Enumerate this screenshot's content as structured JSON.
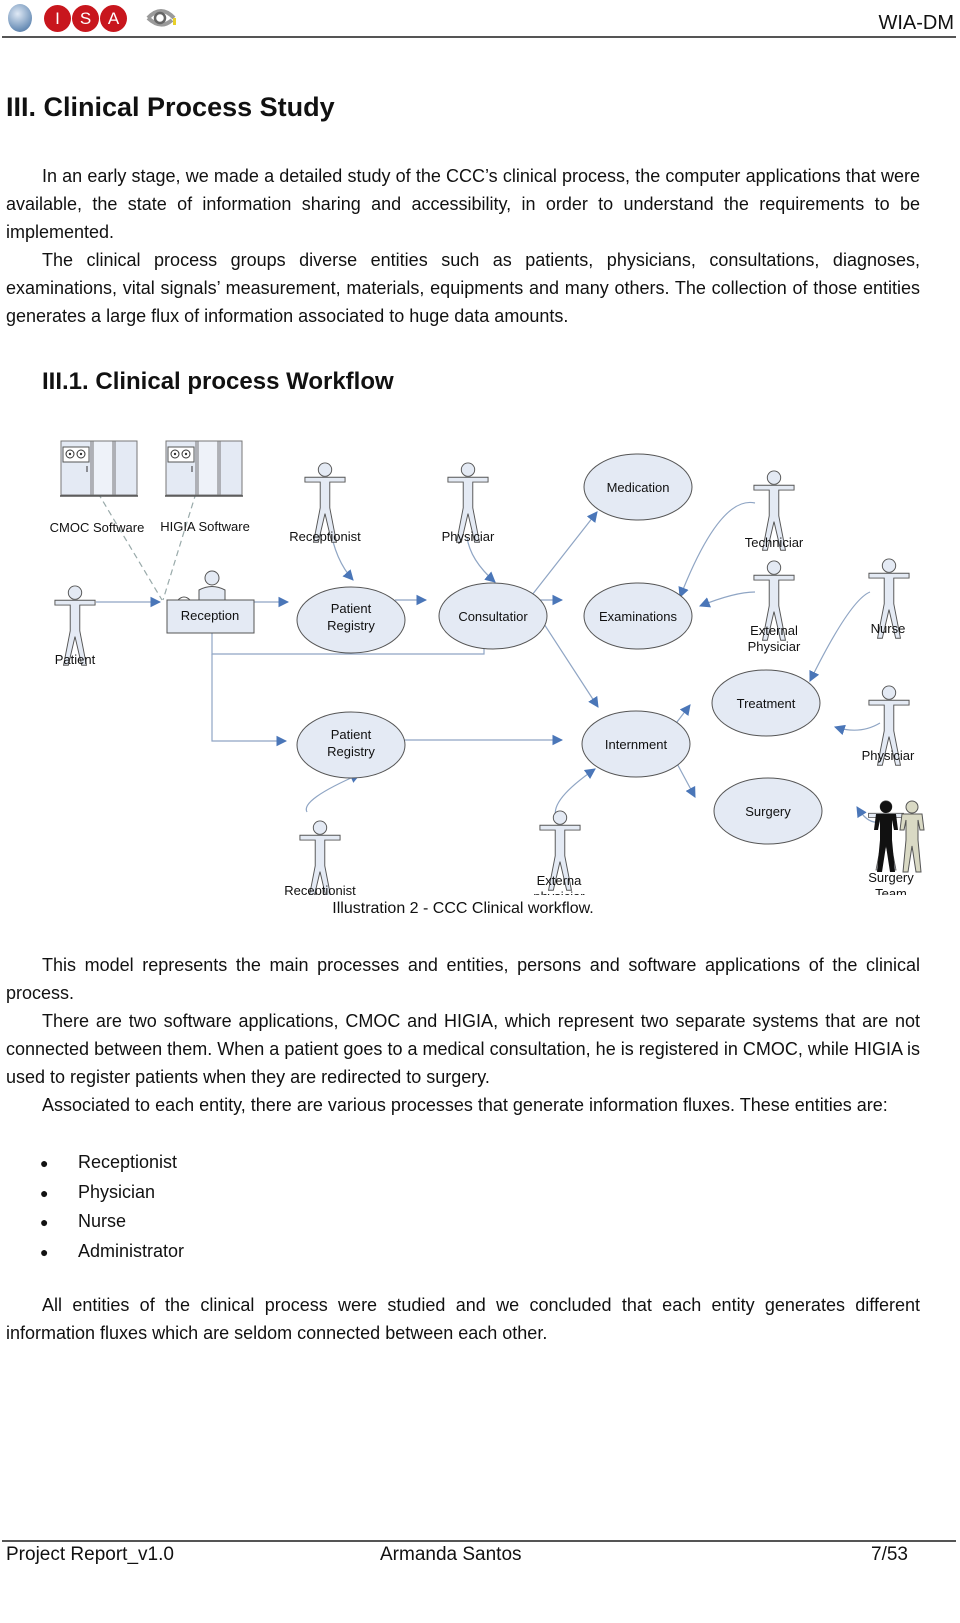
{
  "header": {
    "logos": [
      "globe-logo",
      "I",
      "S",
      "A",
      "eye-logo"
    ],
    "doc_code": "WIA-DM"
  },
  "section": {
    "title": "III. Clinical Process Study",
    "paragraphs": [
      "In an early stage, we made a detailed study of the CCC’s clinical process, the computer applications that were available, the state of information sharing and accessibility, in order to understand the requirements to be implemented.",
      "The clinical process groups diverse entities such as patients, physicians, consultations, diagnoses, examinations, vital signals’ measurement, materials, equipments and many others. The collection of those entities generates a large flux of information associated to huge data amounts."
    ]
  },
  "subsection": {
    "title": "III.1. Clinical process Workflow"
  },
  "diagram": {
    "software": [
      "CMOC Software",
      "HIGIA Software"
    ],
    "actors": {
      "receptionist_top": "Receptionist",
      "physician_top": "Physiciar",
      "technician": "Techniciar",
      "patient": "Patient",
      "external_physician": [
        "External",
        "Physiciar"
      ],
      "nurse": "Nurse",
      "physician_right": "Physiciar",
      "receptionist_bottom": "Receptionist",
      "external_physician_bottom": [
        "Externa",
        "physiciar"
      ],
      "surgery_team": [
        "Surgery",
        "Team"
      ]
    },
    "reception": "Reception",
    "processes": {
      "medication": "Medication",
      "patient_registry_top": [
        "Patient",
        "Registry"
      ],
      "consultation": "Consultatior",
      "examinations": "Examinations",
      "treatment": "Treatment",
      "patient_registry_bottom": [
        "Patient",
        "Registry"
      ],
      "internment": "Internment",
      "surgery": "Surgery"
    },
    "colors": {
      "fill": "#e4eaf4",
      "stroke": "#555555",
      "arrow": "#4a76b8",
      "line": "#8fa5c4"
    },
    "caption": "Illustration 2 - CCC Clinical workflow."
  },
  "body": {
    "paragraphs": [
      "This model represents the main processes and entities, persons and software applications of the clinical process.",
      "There are two software applications, CMOC and HIGIA, which represent two separate systems that are not connected between them. When a patient goes to a medical consultation, he is registered in CMOC, while HIGIA is used to register patients when they are redirected to surgery.",
      "Associated to each entity, there are various processes that generate information fluxes. These entities are:"
    ],
    "bullets": [
      "Receptionist",
      "Physician",
      "Nurse",
      "Administrator"
    ],
    "conclusion": "All entities of the clinical process were studied and we concluded that each entity generates different information fluxes which are seldom connected between each other."
  },
  "footer": {
    "left": "Project Report_v1.0",
    "center": "Armanda Santos",
    "right": "7/53"
  }
}
